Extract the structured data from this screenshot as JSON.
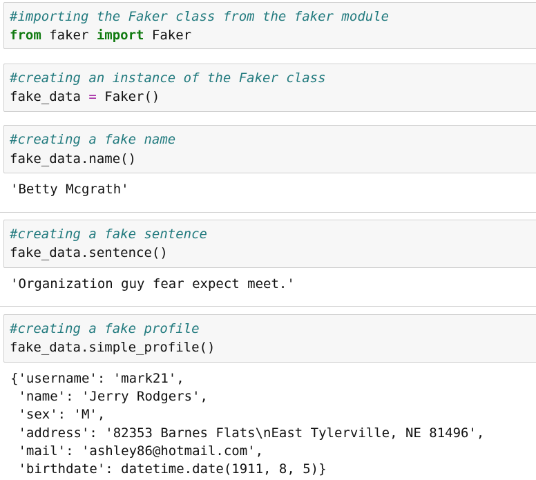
{
  "cells": [
    {
      "comment": "#importing the Faker class from the faker module",
      "code": {
        "kw1": "from",
        "mod": " faker ",
        "kw2": "import",
        "cls": " Faker"
      }
    },
    {
      "comment": "#creating an instance of the Faker class",
      "code": {
        "lhs": "fake_data ",
        "op": "=",
        "rhs": " Faker()"
      }
    },
    {
      "comment": "#creating a fake name",
      "code": "fake_data.name()",
      "output": "'Betty Mcgrath'"
    },
    {
      "comment": "#creating a fake sentence",
      "code": "fake_data.sentence()",
      "output": "'Organization guy fear expect meet.'"
    },
    {
      "comment": "#creating a fake profile",
      "code": "fake_data.simple_profile()",
      "output_lines": [
        "{'username': 'mark21',",
        " 'name': 'Jerry Rodgers',",
        " 'sex': 'M',",
        " 'address': '82353 Barnes Flats\\nEast Tylerville, NE 81496',",
        " 'mail': 'ashley86@hotmail.com',",
        " 'birthdate': datetime.date(1911, 8, 5)}"
      ]
    }
  ]
}
